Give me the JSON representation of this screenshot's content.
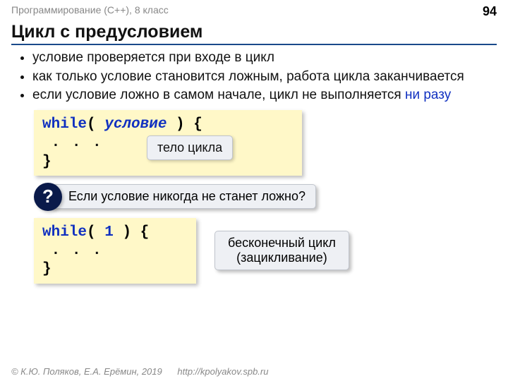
{
  "header": {
    "course": "Программирование (C++), 8 класс",
    "page_number": "94"
  },
  "title": "Цикл с предусловием",
  "bullets": [
    {
      "text": "условие проверяется при входе в цикл"
    },
    {
      "text": "как только условие становится ложным, работа цикла заканчивается"
    },
    {
      "prefix": "если условие ложно в самом начале, цикл не выполняется ",
      "highlight": "ни разу"
    }
  ],
  "code1": {
    "while_kw": "while",
    "open": "( ",
    "cond": "условие",
    "close": " ) {",
    "body": ". . .",
    "end": " }",
    "callout": "тело цикла"
  },
  "question": {
    "badge": "?",
    "text": "Если условие никогда не станет ложно?"
  },
  "code2": {
    "while_kw": "while",
    "open": "( ",
    "cond": "1",
    "close": " ) {",
    "body": ". . .",
    "end": " }"
  },
  "infinite": {
    "line1": "бесконечный цикл",
    "line2": "(зацикливание)"
  },
  "footer": {
    "copyright": "© К.Ю. Поляков, Е.А. Ерёмин, 2019",
    "url": "http://kpolyakov.spb.ru"
  }
}
